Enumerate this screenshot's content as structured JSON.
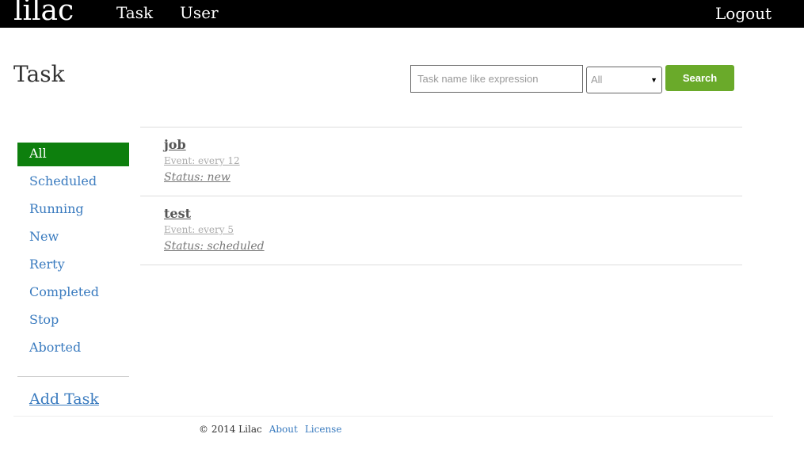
{
  "navbar": {
    "brand": "lilac",
    "links": [
      {
        "label": "Task"
      },
      {
        "label": "User"
      }
    ],
    "logout_label": "Logout"
  },
  "page": {
    "title": "Task"
  },
  "search": {
    "placeholder": "Task name like expression",
    "value": "",
    "status_selected": "All",
    "button_label": "Search"
  },
  "sidebar": {
    "items": [
      {
        "label": "All",
        "active": true
      },
      {
        "label": "Scheduled",
        "active": false
      },
      {
        "label": "Running",
        "active": false
      },
      {
        "label": "New",
        "active": false
      },
      {
        "label": "Rerty",
        "active": false
      },
      {
        "label": "Completed",
        "active": false
      },
      {
        "label": "Stop",
        "active": false
      },
      {
        "label": "Aborted",
        "active": false
      }
    ],
    "add_task_label": "Add Task"
  },
  "tasks": [
    {
      "name": "job",
      "event": "Event: every 12",
      "status": "Status: new"
    },
    {
      "name": "test",
      "event": "Event: every 5",
      "status": "Status: scheduled"
    }
  ],
  "footer": {
    "copyright": "© 2014 Lilac",
    "links": [
      {
        "label": "About"
      },
      {
        "label": "License"
      }
    ]
  },
  "colors": {
    "navbar_bg": "#000000",
    "active_item_bg": "#0d7f0d",
    "search_button_bg": "#6aaa2a",
    "link": "#3a7bbf"
  }
}
